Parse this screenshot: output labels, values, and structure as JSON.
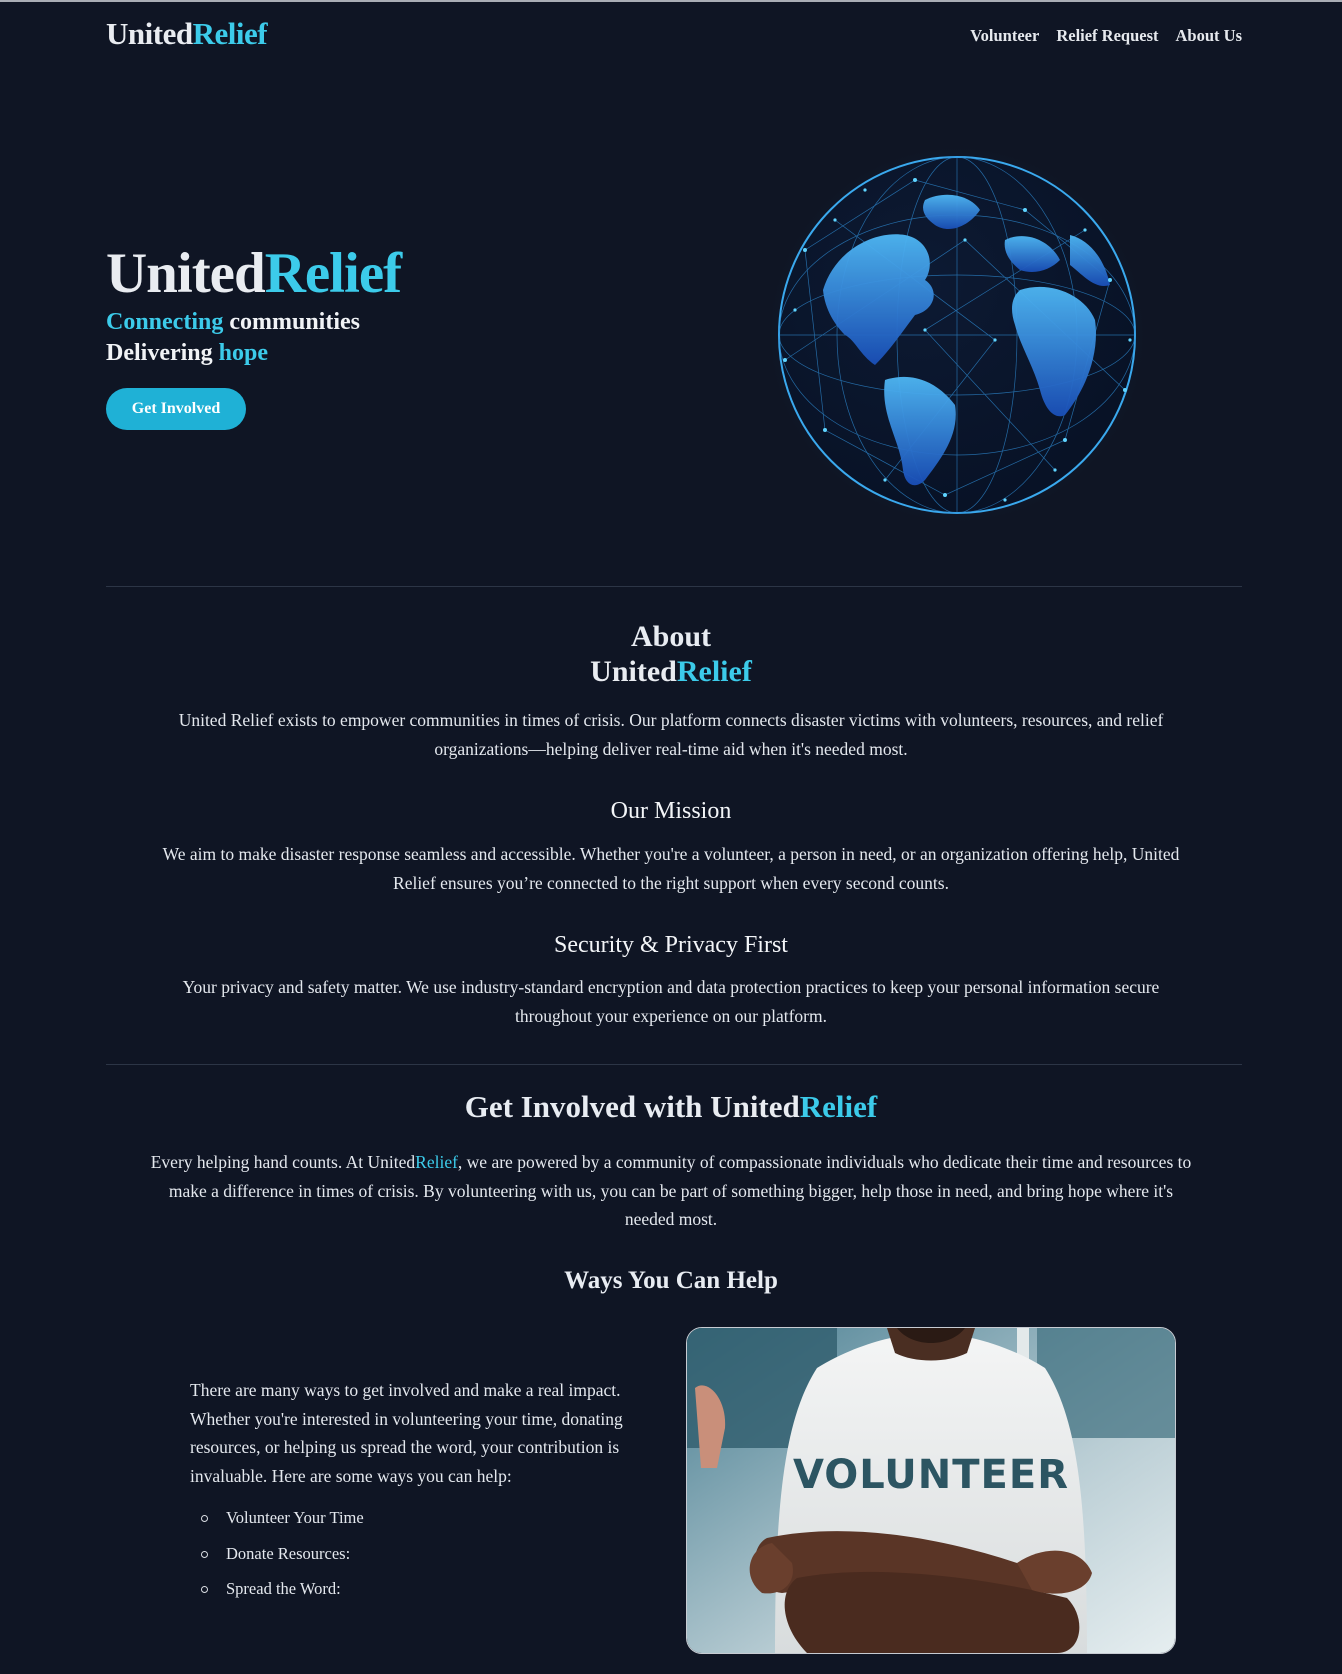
{
  "brand": {
    "part1": "United",
    "part2": "Relief"
  },
  "nav": {
    "links": [
      "Volunteer",
      "Relief Request",
      "About Us"
    ]
  },
  "hero": {
    "line1": {
      "highlight": "Connecting",
      "rest": "communities"
    },
    "line2": {
      "text": "Delivering",
      "highlight": "hope"
    },
    "cta_label": "Get Involved",
    "globe_icon": "world-globe-network-icon"
  },
  "about": {
    "heading": "About",
    "text": "United Relief exists to empower communities in times of crisis. Our platform connects disaster victims with volunteers, resources, and relief organizations—helping deliver real-time aid when it's needed most.",
    "mission_heading": "Our Mission",
    "mission_text": "We aim to make disaster response seamless and accessible. Whether you're a volunteer, a person in need, or an organization offering help, United Relief ensures you’re connected to the right support when every second counts.",
    "security_heading": "Security & Privacy First",
    "security_text": "Your privacy and safety matter. We use industry-standard encryption and data protection practices to keep your personal information secure throughout your experience on our platform."
  },
  "get_involved": {
    "heading_prefix": "Get Involved with ",
    "intro_before": "Every helping hand counts. At ",
    "intro_after": ", we are powered by a community of compassionate individuals who dedicate their time and resources to make a difference in times of crisis. By volunteering with us, you can be part of something bigger, help those in need, and bring hope where it's needed most.",
    "ways_heading": "Ways You Can Help",
    "ways_text": "There are many ways to get involved and make a real impact. Whether you're interested in volunteering your time, donating resources, or helping us spread the word, your contribution is invaluable. Here are some ways you can help:",
    "ways_list": [
      "Volunteer Your Time",
      "Donate Resources:",
      "Spread the Word:"
    ],
    "photo_shirt_text": "VOLUNTEER"
  },
  "colors": {
    "background": "#0f1524",
    "accent": "#3ccbea",
    "button": "#1fb1d6"
  }
}
